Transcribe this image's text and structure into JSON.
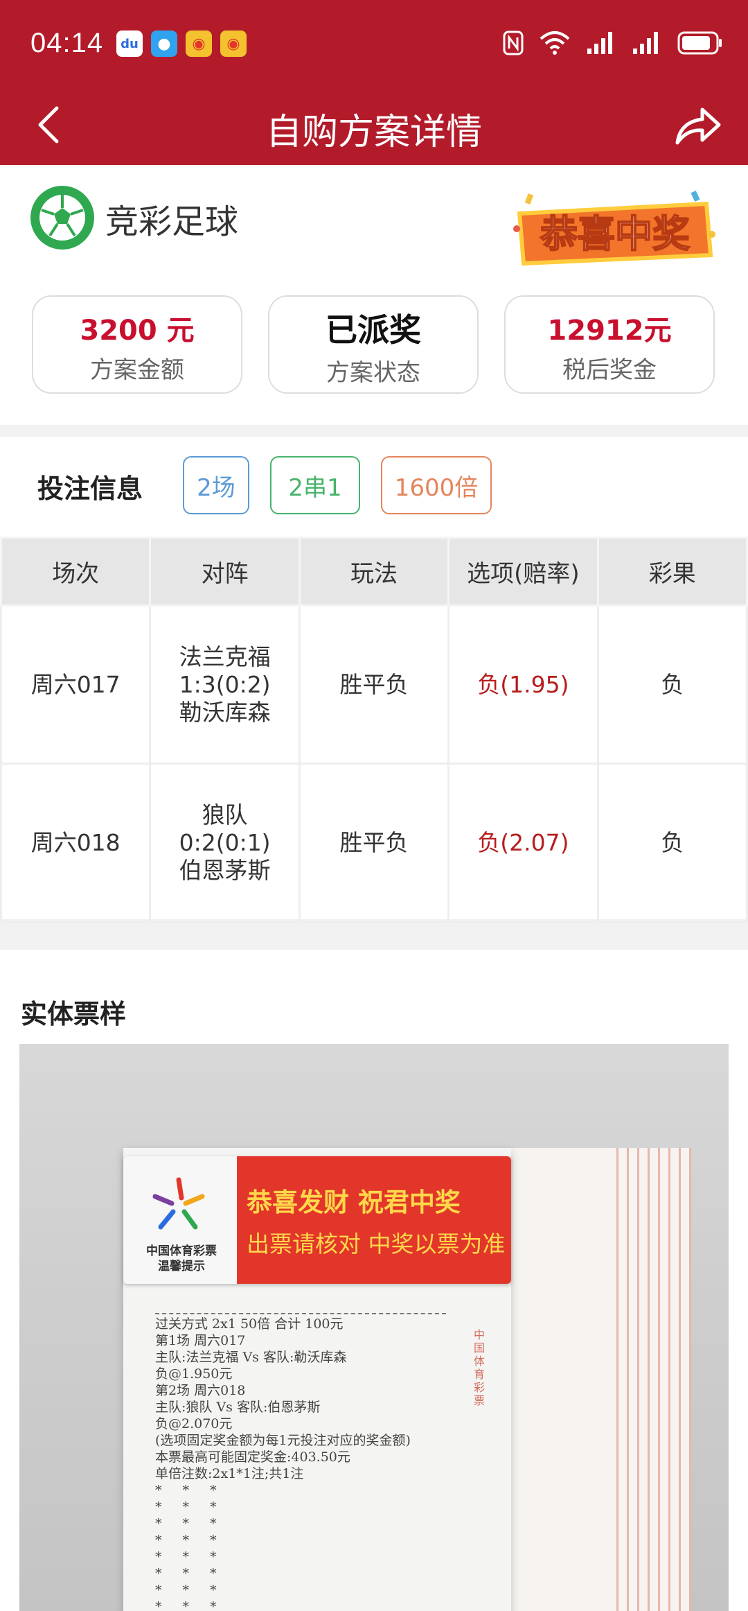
{
  "status_bar": {
    "time": "04:14",
    "notifications": [
      "baidu-icon",
      "message-icon",
      "weibo-icon",
      "weibo-icon"
    ],
    "system": [
      "nfc-icon",
      "wifi-icon",
      "signal-icon",
      "signal-icon",
      "battery-icon"
    ]
  },
  "nav": {
    "title": "自购方案详情"
  },
  "lottery": {
    "name": "竞彩足球",
    "badge_text": "恭喜中奖"
  },
  "summary": [
    {
      "value": "3200 元",
      "label": "方案金额"
    },
    {
      "value": "已派奖",
      "label": "方案状态"
    },
    {
      "value": "12912元",
      "label": "税后奖金"
    }
  ],
  "bet_info": {
    "title": "投注信息",
    "tags": [
      "2场",
      "2串1",
      "1600倍"
    ],
    "columns": [
      "场次",
      "对阵",
      "玩法",
      "选项(赔率)",
      "彩果"
    ],
    "rows": [
      {
        "match_no": "周六017",
        "home": "法兰克福",
        "score": "1:3(0:2)",
        "away": "勒沃库森",
        "play": "胜平负",
        "option": "负(1.95)",
        "result": "负"
      },
      {
        "match_no": "周六018",
        "home": "狼队",
        "score": "0:2(0:1)",
        "away": "伯恩茅斯",
        "play": "胜平负",
        "option": "负(2.07)",
        "result": "负"
      }
    ]
  },
  "ticket": {
    "title": "实体票样",
    "sign_org_line1": "中国体育彩票",
    "sign_org_line2": "温馨提示",
    "sign_line1": "恭喜发财 祝君中奖",
    "sign_line2": "出票请核对 中奖以票为准",
    "side_text": "中国体育彩票",
    "receipt_lines": [
      "过关方式  2x1        50倍       合计  100元",
      "第1场  周六017",
      "主队:法兰克福 Vs 客队:勒沃库森",
      "负@1.950元",
      "第2场  周六018",
      "主队:狼队 Vs 客队:伯恩茅斯",
      "负@2.070元",
      "(选项固定奖金额为每1元投注对应的奖金额)",
      "本票最高可能固定奖金:403.50元",
      "单倍注数:2x1*1注;共1注"
    ],
    "stars": [
      "* * *",
      "* * *",
      "* * *",
      "* * *",
      "* * *",
      "* * *",
      "* * *",
      "* * *"
    ]
  },
  "colors": {
    "brand_red": "#b31b2a",
    "accent_red": "#c8102e",
    "tag_blue": "#5a9bd5",
    "tag_green": "#47b36a",
    "tag_orange": "#e4855b"
  }
}
